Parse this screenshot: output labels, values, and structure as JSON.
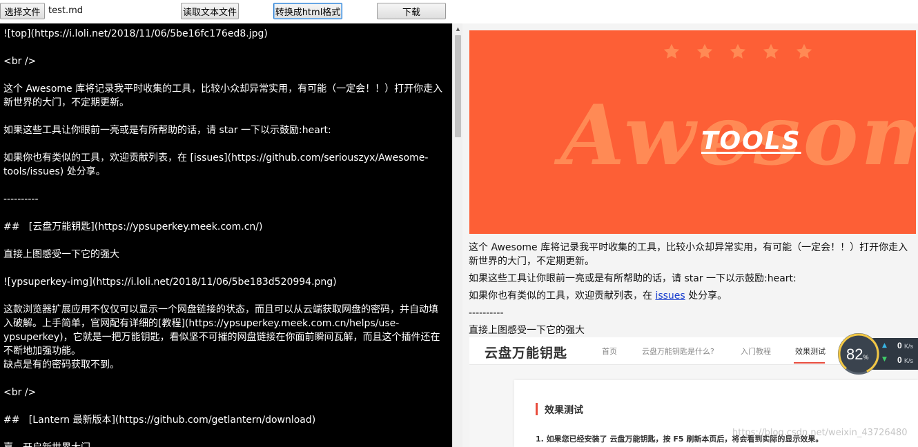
{
  "toolbar": {
    "choose_file": "选择文件",
    "file_name": "test.md",
    "read_text": "读取文本文件",
    "convert_html": "转换成html格式",
    "download": "下载"
  },
  "editor": {
    "lines": [
      "![top](https://i.loli.net/2018/11/06/5be16fc176ed8.jpg)",
      "<br />",
      "这个 Awesome 库将记录我平时收集的工具，比较小众却异常实用，有可能（一定会！！）打开你走入新世界的大门，不定期更新。",
      "如果这些工具让你眼前一亮或是有所帮助的话，请 star 一下以示鼓励:heart:",
      "如果你也有类似的工具，欢迎贡献列表，在 [issues](https://github.com/seriouszyx/Awesome-tools/issues) 处分享。",
      "----------",
      "##   [云盘万能钥匙](https://ypsuperkey.meek.com.cn/)",
      "直接上图感受一下它的强大",
      "![ypsuperkey-img](https://i.loli.net/2018/11/06/5be183d520994.png)",
      "这款浏览器扩展应用不仅仅可以显示一个网盘链接的状态，而且可以从云端获取网盘的密码，并自动填入破解。上手简单，官网配有详细的[教程](https://ypsuperkey.meek.com.cn/helps/use-ypsuperkey)，它就是一把万能钥匙，看似坚不可摧的网盘链接在你面前瞬间瓦解，而且这个插件还在不断地加强功能。",
      "缺点是有的密码获取不到。",
      "<br />",
      "##   [Lantern 最新版本](https://github.com/getlantern/download)",
      "嘉，开启新世界大门"
    ]
  },
  "preview": {
    "banner_word": "Awesome",
    "banner_sub": "TOOLS",
    "para1": "这个 Awesome 库将记录我平时收集的工具，比较小众却异常实用，有可能（一定会！！）打开你走入新世界的大门，不定期更新。",
    "para2": "如果这些工具让你眼前一亮或是有所帮助的话，请 star 一下以示鼓励:heart:",
    "para3_before": "如果你也有类似的工具，欢迎贡献列表，在 ",
    "para3_link": "issues",
    "para3_after": " 处分享。",
    "hr": "----------",
    "para4": "直接上图感受一下它的强大",
    "shot": {
      "logo": "云盘万能钥匙",
      "nav": [
        "首页",
        "云盘万能钥匙是什么?",
        "入门教程",
        "效果测试"
      ],
      "card_title": "效果测试",
      "step1": "1. 如果您已经安装了 云盘万能钥匙，按 F5 刷新本页后，将会看到实际的显示效果。",
      "watermark": "https://blog.csdn.net/weixin_43726480"
    }
  },
  "widget": {
    "percent": "82",
    "percent_sign": "%",
    "up": "0",
    "down": "0",
    "unit": "K/s",
    "ring_color": "#f2c744"
  }
}
